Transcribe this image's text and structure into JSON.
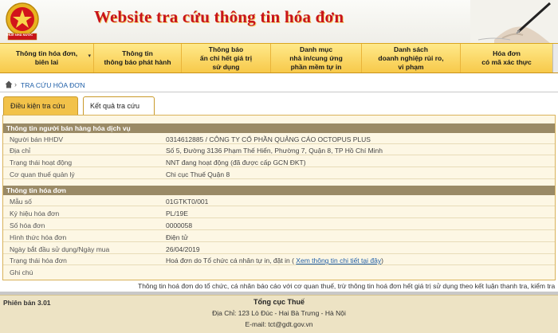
{
  "header": {
    "title": "Website tra cứu thông tin hóa đơn",
    "emblem_text": "THUẾ NHÀ NƯỚC"
  },
  "menu": {
    "items": [
      {
        "line1": "Thông tin hóa đơn,",
        "line2": "biên lai"
      },
      {
        "line1": "Thông tin",
        "line2": "thông báo phát hành"
      },
      {
        "line1": "Thông báo",
        "line2": "ấn chỉ hết giá trị",
        "line3": "sử dụng"
      },
      {
        "line1": "Danh mục",
        "line2": "nhà in/cung ứng",
        "line3": "phần mềm tự in"
      },
      {
        "line1": "Danh sách",
        "line2": "doanh nghiệp rủi ro,",
        "line3": "vi phạm"
      },
      {
        "line1": "Hóa đơn",
        "line2": "có mã xác thực"
      }
    ]
  },
  "breadcrumb": {
    "label": "TRA CỨU HÓA ĐƠN"
  },
  "tabs": {
    "conditions": "Điều kiện tra cứu",
    "results": "Kết quả tra cứu"
  },
  "seller": {
    "heading": "Thông tin người bán hàng hóa dịch vụ",
    "rows": [
      {
        "label": "Người bán HHDV",
        "value": "0314612885 / CÔNG TY CỔ PHẦN QUẢNG CÁO OCTOPUS PLUS"
      },
      {
        "label": "Địa chỉ",
        "value": "Số 5, Đường 3136 Phạm Thế Hiển, Phường 7, Quận 8, TP Hồ Chí Minh"
      },
      {
        "label": "Trạng thái hoạt động",
        "value": "NNT đang hoạt động (đã được cấp GCN ĐKT)"
      },
      {
        "label": "Cơ quan thuế quản lý",
        "value": "Chi cục Thuế Quận 8"
      }
    ]
  },
  "invoice": {
    "heading": "Thông tin hóa đơn",
    "rows": [
      {
        "label": "Mẫu số",
        "value": "01GTKT0/001"
      },
      {
        "label": "Ký hiệu hóa đơn",
        "value": "PL/19E"
      },
      {
        "label": "Số hóa đơn",
        "value": "0000058"
      },
      {
        "label": "Hình thức hóa đơn",
        "value": "Điện tử"
      },
      {
        "label": "Ngày bắt đầu sử dụng/Ngày mua",
        "value": "26/04/2019"
      },
      {
        "label": "Trạng thái hóa đơn",
        "value": "Hoá đơn do Tổ chức cá nhân tự in, đặt in (",
        "link": "Xem thông tin chi tiết tại đây",
        "suffix": ")"
      },
      {
        "label": "Ghi chú",
        "value": ""
      }
    ]
  },
  "notice": "Thông tin hoá đơn do tổ chức, cá nhân báo cáo với cơ quan thuế, trừ thông tin hoá đơn hết giá trị sử dụng theo kết luận thanh tra, kiểm tra",
  "footer": {
    "version": "Phiên bản 3.01",
    "org": "Tổng cục Thuế",
    "address": "Địa Chỉ: 123 Lò Đúc - Hai Bà Trưng - Hà Nội",
    "email": "E-mail: tct@gdt.gov.vn"
  },
  "colors": {
    "title": "#c8141b",
    "menu": "#f7c94a",
    "section": "#9a8a66",
    "link": "#1f5fa8"
  }
}
